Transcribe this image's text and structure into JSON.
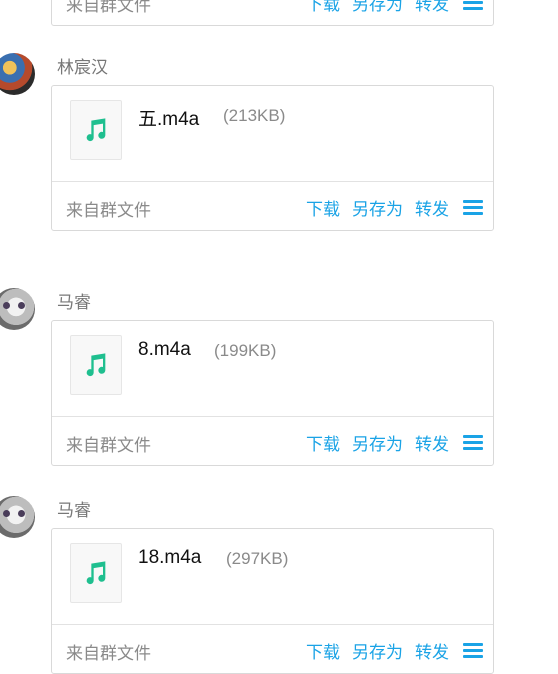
{
  "messages": [
    {
      "sender": "",
      "file": {
        "name": "",
        "size": ""
      },
      "source": "来自群文件",
      "actions": {
        "download": "下载",
        "save_as": "另存为",
        "forward": "转发"
      }
    },
    {
      "sender": "林宸汉",
      "file": {
        "name": "五.m4a",
        "size": "(213KB)"
      },
      "source": "来自群文件",
      "actions": {
        "download": "下载",
        "save_as": "另存为",
        "forward": "转发"
      }
    },
    {
      "sender": "马睿",
      "file": {
        "name": "8.m4a",
        "size": "(199KB)"
      },
      "source": "来自群文件",
      "actions": {
        "download": "下载",
        "save_as": "另存为",
        "forward": "转发"
      }
    },
    {
      "sender": "马睿",
      "file": {
        "name": "18.m4a",
        "size": "(297KB)"
      },
      "source": "来自群文件",
      "actions": {
        "download": "下载",
        "save_as": "另存为",
        "forward": "转发"
      }
    }
  ],
  "colors": {
    "accent": "#1aa3e6",
    "music_icon": "#1fbf8f"
  },
  "icons": {
    "file": "music-note-icon",
    "menu": "hamburger-menu-icon"
  }
}
